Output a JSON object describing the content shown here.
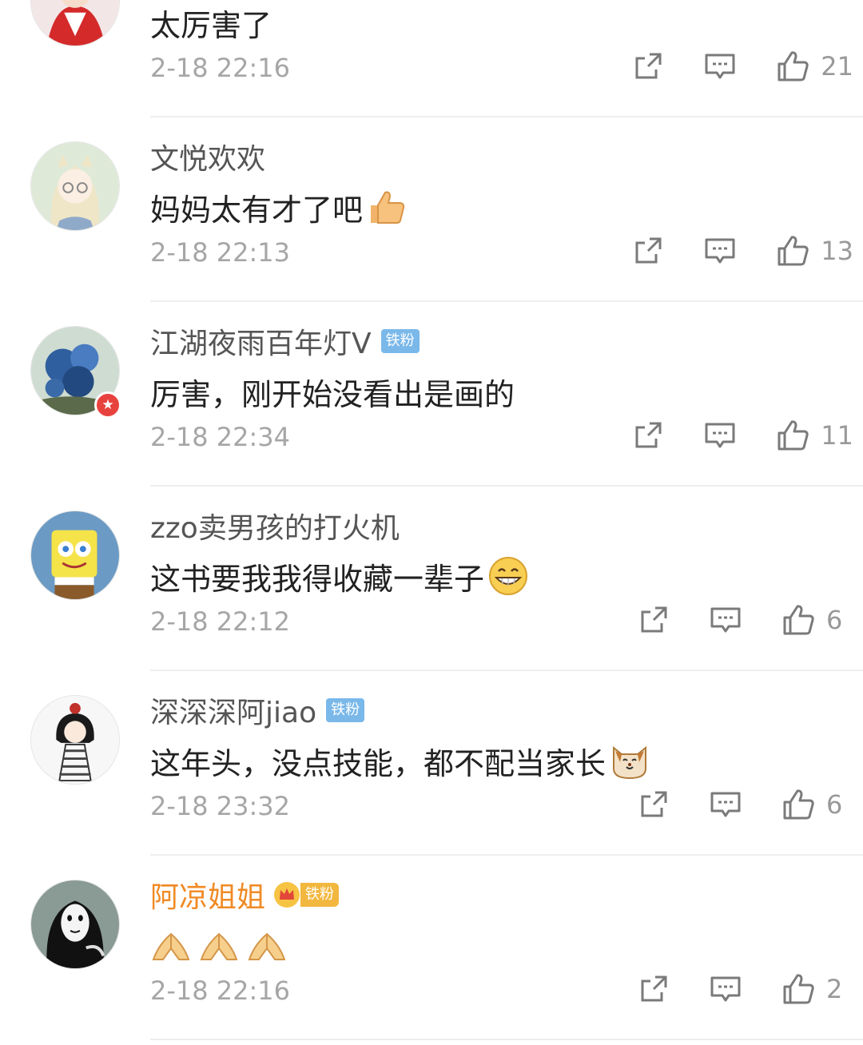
{
  "comments": [
    {
      "name": "",
      "text": "太厉害了",
      "time": "2-18 22:16",
      "likes": "21",
      "emoji": "",
      "tag": "",
      "vip": false,
      "verified": false
    },
    {
      "name": "文悦欢欢",
      "text": "妈妈太有才了吧",
      "time": "2-18 22:13",
      "likes": "13",
      "emoji": "thumbs-up",
      "tag": "",
      "vip": false,
      "verified": false
    },
    {
      "name": "江湖夜雨百年灯V",
      "text": "厉害，刚开始没看出是画的",
      "time": "2-18 22:34",
      "likes": "11",
      "emoji": "",
      "tag": "铁粉",
      "vip": false,
      "verified": true
    },
    {
      "name": "zzo卖男孩的打火机",
      "text": "这书要我我得收藏一辈子",
      "time": "2-18 22:12",
      "likes": "6",
      "emoji": "grin",
      "tag": "",
      "vip": false,
      "verified": false
    },
    {
      "name": "深深深阿jiao",
      "text": "这年头，没点技能，都不配当家长",
      "time": "2-18 23:32",
      "likes": "6",
      "emoji": "cat",
      "tag": "铁粉",
      "vip": false,
      "verified": false
    },
    {
      "name": "阿凉姐姐",
      "text": "",
      "time": "2-18 22:16",
      "likes": "2",
      "emoji": "pray",
      "tag": "铁粉",
      "vip": true,
      "verified": false
    }
  ],
  "icons": {
    "share": "share-icon",
    "reply": "comment-icon",
    "like": "thumbs-up-icon"
  },
  "colors": {
    "vip_name": "#f08a24",
    "tag_blue": "#7ab8ea",
    "tag_gold": "#f2b73e",
    "time": "#a6a6a6"
  }
}
